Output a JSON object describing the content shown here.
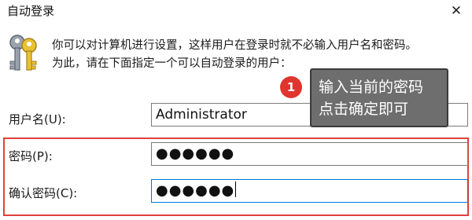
{
  "window": {
    "title": "自动登录",
    "close_glyph": "✕"
  },
  "description": {
    "line1": "你可以对计算机进行设置，这样用户在登录时就不必输入用户名和密码。",
    "line2": "为此，请在下面指定一个可以自动登录的用户："
  },
  "form": {
    "username_label": "用户名(U):",
    "username_value": "Administrator",
    "password_label": "密码(P):",
    "password_value": "●●●●●●",
    "confirm_label": "确认密码(C):",
    "confirm_value": "●●●●●●"
  },
  "annotation": {
    "step_number": "1",
    "line1": "输入当前的密码",
    "line2": "点击确定即可"
  },
  "colors": {
    "highlight": "#e0403a",
    "badge": "#e0352f",
    "callout_bg": "#6e6e6e"
  },
  "icons": {
    "window_close": "close-icon",
    "header": "keys-icon"
  }
}
